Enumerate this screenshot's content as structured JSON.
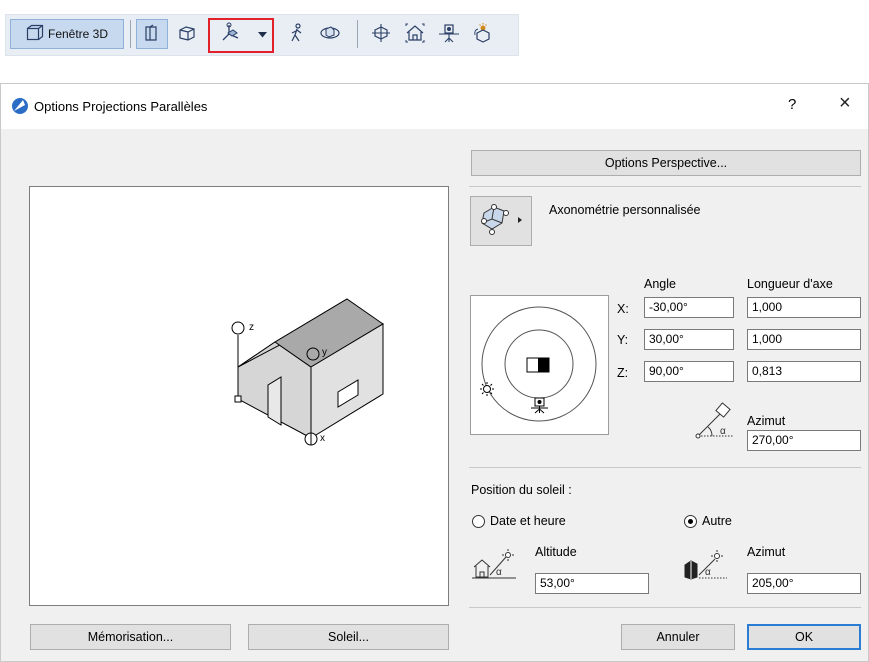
{
  "toolbar": {
    "window_3d_label": "Fenêtre 3D",
    "icons": [
      "3d-window-icon",
      "wall-section-icon",
      "box-icon",
      "axonometry-icon",
      "dropdown-arrow-icon",
      "walker-icon",
      "orbit-icon",
      "grid-object-icon",
      "house-view-icon",
      "camera-icon",
      "sun-rotate-icon"
    ],
    "highlight_color": "#e2202a"
  },
  "dialog": {
    "title": "Options Projections Parallèles",
    "help": "?",
    "close": "×",
    "perspective_options_button": "Options Perspective...",
    "projection_type": "Axonométrie personnalisée",
    "headers": {
      "angle": "Angle",
      "axis_length": "Longueur d'axe"
    },
    "axes": [
      {
        "label": "X:",
        "angle": "-30,00°",
        "length": "1,000"
      },
      {
        "label": "Y:",
        "angle": "30,00°",
        "length": "1,000"
      },
      {
        "label": "Z:",
        "angle": "90,00°",
        "length": "0,813"
      }
    ],
    "camera_azimuth": {
      "label": "Azimut",
      "value": "270,00°"
    },
    "sun_section": {
      "title": "Position du soleil :",
      "option_date": "Date et heure",
      "option_other": "Autre",
      "selected": "Autre",
      "altitude": {
        "label": "Altitude",
        "value": "53,00°"
      },
      "azimuth": {
        "label": "Azimut",
        "value": "205,00°"
      }
    },
    "preview_labels": {
      "z": "z",
      "y": "y",
      "x": "x"
    },
    "buttons": {
      "memorize": "Mémorisation...",
      "sun": "Soleil...",
      "cancel": "Annuler",
      "ok": "OK"
    }
  },
  "colors": {
    "accent": "#2b7cd3",
    "toolbar_bg": "#e9eef5",
    "dialog_bg": "#f0f0f0"
  }
}
